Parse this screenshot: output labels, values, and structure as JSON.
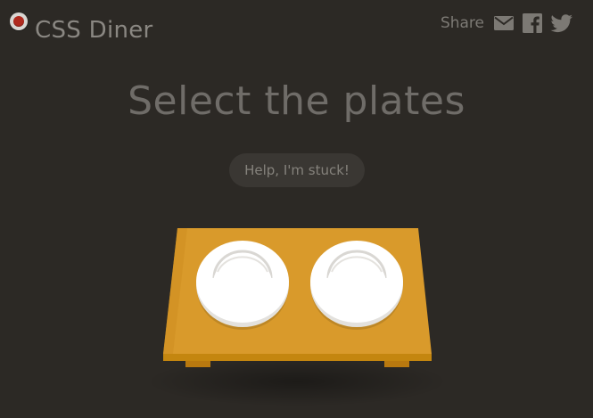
{
  "header": {
    "logo_text": "CSS Diner",
    "share_label": "Share",
    "share_icons": [
      "email-icon",
      "facebook-icon",
      "twitter-icon"
    ]
  },
  "level": {
    "title": "Select the plates"
  },
  "help": {
    "label": "Help, I'm stuck!"
  },
  "table": {
    "items": [
      "plate",
      "plate"
    ]
  },
  "colors": {
    "background": "#2c2925",
    "table_top": "#d99a2b",
    "table_front": "#c88718",
    "plate": "#ffffff",
    "logo_dot": "#b02a1e",
    "text_muted": "#6f6c68"
  }
}
